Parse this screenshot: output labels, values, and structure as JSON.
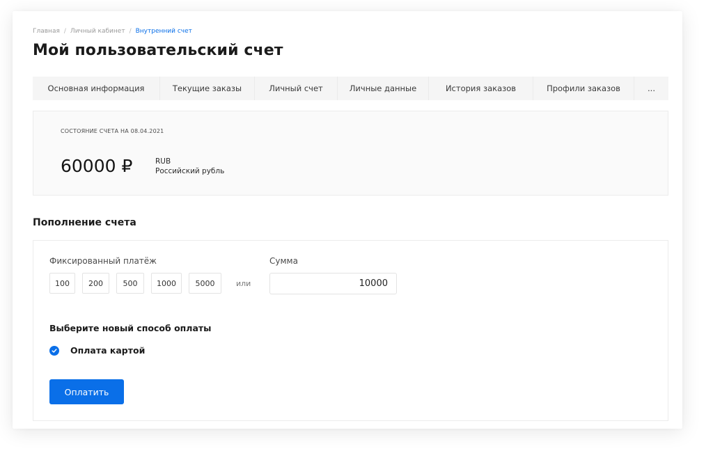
{
  "breadcrumb": {
    "items": [
      "Главная",
      "Личный кабинет",
      "Внутренний счет"
    ],
    "separator": "/"
  },
  "page_title": "Мой пользовательский счет",
  "tabs": [
    {
      "label": "Основная информация"
    },
    {
      "label": "Текущие заказы"
    },
    {
      "label": "Личный счет"
    },
    {
      "label": "Личные данные"
    },
    {
      "label": "История заказов"
    },
    {
      "label": "Профили заказов"
    },
    {
      "label": "..."
    }
  ],
  "balance": {
    "caption": "СОСТОЯНИЕ СЧЕТА НА 08.04.2021",
    "amount": "60000 ₽",
    "currency_code": "RUB",
    "currency_name": "Российский рубль"
  },
  "topup": {
    "section_title": "Пополнение счета",
    "fixed_label": "Фиксированный платёж",
    "amount_options": [
      "100",
      "200",
      "500",
      "1000",
      "5000"
    ],
    "or_label": "или",
    "sum_label": "Сумма",
    "sum_value": "10000",
    "method_title": "Выберите новый способ оплаты",
    "method_option": "Оплата картой",
    "method_icon": "check-circle-icon",
    "pay_button": "Оплатить"
  },
  "colors": {
    "accent": "#0a6fe8",
    "tabs_bg": "#f5f5f5",
    "balance_bg": "#fafafa"
  }
}
